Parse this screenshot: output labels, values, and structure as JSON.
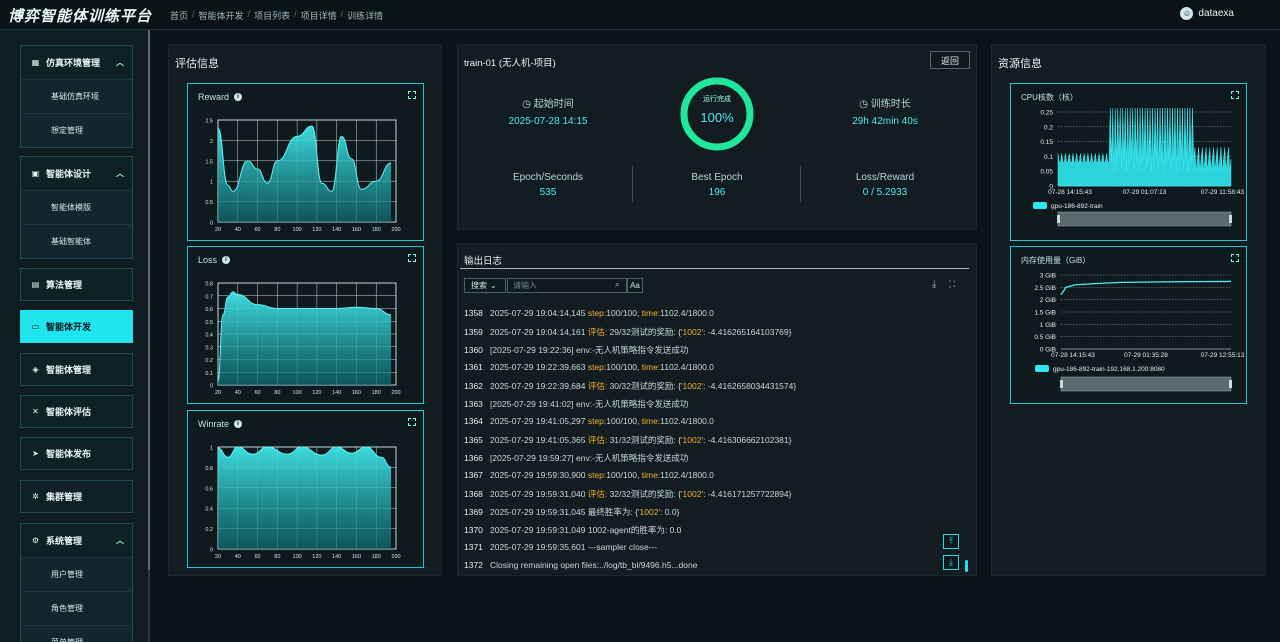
{
  "app": {
    "title": "博弈智能体训练平台",
    "user": "dataexa"
  },
  "breadcrumbs": [
    "首页",
    "智能体开发",
    "项目列表",
    "项目详情",
    "训练详情"
  ],
  "sidebar": {
    "groups": [
      {
        "label": "仿真环境管理",
        "subitems": [
          "基础仿真环境",
          "想定管理"
        ]
      },
      {
        "label": "智能体设计",
        "subitems": [
          "智能体模版",
          "基础智能体"
        ]
      }
    ],
    "items": [
      "算法管理",
      "智能体开发",
      "智能体管理",
      "智能体评估",
      "智能体发布",
      "集群管理"
    ],
    "system": {
      "label": "系统管理",
      "subitems": [
        "用户管理",
        "角色管理",
        "菜单管理"
      ]
    }
  },
  "eval": {
    "title": "评估信息",
    "reward": {
      "title": "Reward",
      "x": [
        20,
        40,
        60,
        80,
        100,
        120,
        140,
        160,
        180,
        200
      ],
      "ylabels": [
        "0",
        "0.5",
        "1",
        "1.5",
        "2",
        "2.5"
      ],
      "points": [
        [
          20,
          2.3
        ],
        [
          30,
          0.9
        ],
        [
          35,
          0.75
        ],
        [
          50,
          1.5
        ],
        [
          60,
          1.3
        ],
        [
          70,
          0.95
        ],
        [
          80,
          1.5
        ],
        [
          100,
          2.1
        ],
        [
          115,
          2.35
        ],
        [
          125,
          0.95
        ],
        [
          135,
          0.75
        ],
        [
          145,
          2.1
        ],
        [
          155,
          1.55
        ],
        [
          165,
          0.8
        ],
        [
          180,
          1.0
        ],
        [
          195,
          1.45
        ]
      ],
      "ymax": 2.5
    },
    "loss": {
      "title": "Loss",
      "x": [
        20,
        40,
        60,
        80,
        100,
        120,
        140,
        160,
        180,
        200
      ],
      "ylabels": [
        "0",
        "0.1",
        "0.2",
        "0.3",
        "0.4",
        "0.5",
        "0.6",
        "0.7",
        "0.8"
      ],
      "points": [
        [
          20,
          0.03
        ],
        [
          25,
          0.55
        ],
        [
          30,
          0.69
        ],
        [
          35,
          0.73
        ],
        [
          40,
          0.71
        ],
        [
          60,
          0.63
        ],
        [
          80,
          0.6
        ],
        [
          100,
          0.6
        ],
        [
          120,
          0.6
        ],
        [
          140,
          0.6
        ],
        [
          160,
          0.61
        ],
        [
          180,
          0.6
        ],
        [
          195,
          0.55
        ]
      ],
      "ymax": 0.8
    },
    "winrate": {
      "title": "Winrate",
      "x": [
        20,
        40,
        60,
        80,
        100,
        120,
        140,
        160,
        180,
        200
      ],
      "ylabels": [
        "0",
        "0.2",
        "0.4",
        "0.6",
        "0.8",
        "1"
      ],
      "points": [
        [
          20,
          0.99
        ],
        [
          30,
          0.9
        ],
        [
          40,
          1.0
        ],
        [
          55,
          0.93
        ],
        [
          70,
          1.0
        ],
        [
          90,
          0.93
        ],
        [
          105,
          1.0
        ],
        [
          125,
          0.92
        ],
        [
          140,
          1.0
        ],
        [
          155,
          0.94
        ],
        [
          170,
          1.0
        ],
        [
          185,
          0.9
        ],
        [
          195,
          0.8
        ]
      ],
      "ymax": 1.0
    }
  },
  "train": {
    "name": "train-01 (无人机-项目)",
    "back": "返回",
    "progress_label": "运行完成",
    "progress_value": "100%",
    "progress_fraction": 1.0,
    "start_label": "起始时间",
    "start_value": "2025-07-28 14:15",
    "duration_label": "训练时长",
    "duration_value": "29h 42min 40s",
    "epoch_label": "Epoch/Seconds",
    "epoch_value": "535",
    "best_label": "Best Epoch",
    "best_value": "196",
    "loss_label": "Loss/Reward",
    "loss_value": "0 / 5.2933"
  },
  "log": {
    "title": "输出日志",
    "search_select": "搜索",
    "search_placeholder": "请输入",
    "aa": "Aa",
    "lines": [
      {
        "n": "1358",
        "t": "2025-07-29 19:04:14,145 ",
        "parts": [
          [
            "step:",
            1
          ],
          [
            "100/100, ",
            0
          ],
          [
            "time:",
            1
          ],
          [
            "1102.4/1800.0",
            0
          ]
        ]
      },
      {
        "n": "1359",
        "t": "2025-07-29 19:04:14,161 ",
        "parts": [
          [
            "评估: ",
            1
          ],
          [
            "29/32测试的奖励: {",
            0
          ],
          [
            "'1002'",
            1
          ],
          [
            ": -4.416265164103769}",
            0
          ]
        ]
      },
      {
        "n": "1360",
        "t": "[2025-07-29 19:22:36] ",
        "parts": [
          [
            "env:-无人机策略指令发送成功",
            0
          ]
        ]
      },
      {
        "n": "1361",
        "t": "2025-07-29 19:22:39,663 ",
        "parts": [
          [
            "step:",
            1
          ],
          [
            "100/100, ",
            0
          ],
          [
            "time:",
            1
          ],
          [
            "1102.4/1800.0",
            0
          ]
        ]
      },
      {
        "n": "1362",
        "t": "2025-07-29 19:22:39,684 ",
        "parts": [
          [
            "评估: ",
            1
          ],
          [
            "30/32测试的奖励: {",
            0
          ],
          [
            "'1002'",
            1
          ],
          [
            ": -4.4162658034431574}",
            0
          ]
        ]
      },
      {
        "n": "1363",
        "t": "[2025-07-29 19:41:02] ",
        "parts": [
          [
            "env:-无人机策略指令发送成功",
            0
          ]
        ]
      },
      {
        "n": "1364",
        "t": "2025-07-29 19:41:05,297 ",
        "parts": [
          [
            "step:",
            1
          ],
          [
            "100/100, ",
            0
          ],
          [
            "time:",
            1
          ],
          [
            "1102.4/1800.0",
            0
          ]
        ]
      },
      {
        "n": "1365",
        "t": "2025-07-29 19:41:05,365 ",
        "parts": [
          [
            "评估: ",
            1
          ],
          [
            "31/32测试的奖励: {",
            0
          ],
          [
            "'1002'",
            1
          ],
          [
            ": -4.416306662102381}",
            0
          ]
        ]
      },
      {
        "n": "1366",
        "t": "[2025-07-29 19:59:27] ",
        "parts": [
          [
            "env:-无人机策略指令发送成功",
            0
          ]
        ]
      },
      {
        "n": "1367",
        "t": "2025-07-29 19:59:30,900 ",
        "parts": [
          [
            "step:",
            1
          ],
          [
            "100/100, ",
            0
          ],
          [
            "time:",
            1
          ],
          [
            "1102.4/1800.0",
            0
          ]
        ]
      },
      {
        "n": "1368",
        "t": "2025-07-29 19:59:31,040 ",
        "parts": [
          [
            "评估: ",
            1
          ],
          [
            "32/32测试的奖励: {",
            0
          ],
          [
            "'1002'",
            1
          ],
          [
            ": -4.416171257722894}",
            0
          ]
        ]
      },
      {
        "n": "1369",
        "t": "2025-07-29 19:59:31,045 ",
        "parts": [
          [
            "最终胜率为: {",
            0
          ],
          [
            "'1002'",
            1
          ],
          [
            ": 0.0}",
            0
          ]
        ]
      },
      {
        "n": "1370",
        "t": "2025-07-29 19:59:31,049 ",
        "parts": [
          [
            "1002-agent的胜率为: 0.0",
            0
          ]
        ]
      },
      {
        "n": "1371",
        "t": "2025-07-29 19:59:35,601 ",
        "parts": [
          [
            "---sampler close---",
            0
          ]
        ]
      },
      {
        "n": "1372",
        "t": "Closing remaining open files:../log/tb_bl/9496.h5...done",
        "parts": []
      }
    ]
  },
  "resources": {
    "title": "资源信息",
    "cpu": {
      "title": "CPU核数（核）",
      "ylabels": [
        "0",
        "0.05",
        "0.1",
        "0.15",
        "0.2",
        "0.25"
      ],
      "xlabels": [
        "07-28 14:15:43",
        "07-29 01:07:13",
        "07-29 11:58:43"
      ],
      "legend": "gpu-186-892-train"
    },
    "mem": {
      "title": "内存使用量（GiB）",
      "ylabels": [
        "0 GiB",
        "0.5 GiB",
        "1 GiB",
        "1.5 GiB",
        "2 GiB",
        "2.5 GiB",
        "3 GiB"
      ],
      "xlabels": [
        "07-28 14:15:43",
        "07-29 01:35:28",
        "07-29 12:55:13"
      ],
      "legend": "gpu-186-892-train-192.168.1.200:8080"
    }
  },
  "colors": {
    "accent": "#1fe6ee",
    "highlight": "#f0b030",
    "ring": "#1fe89a"
  }
}
